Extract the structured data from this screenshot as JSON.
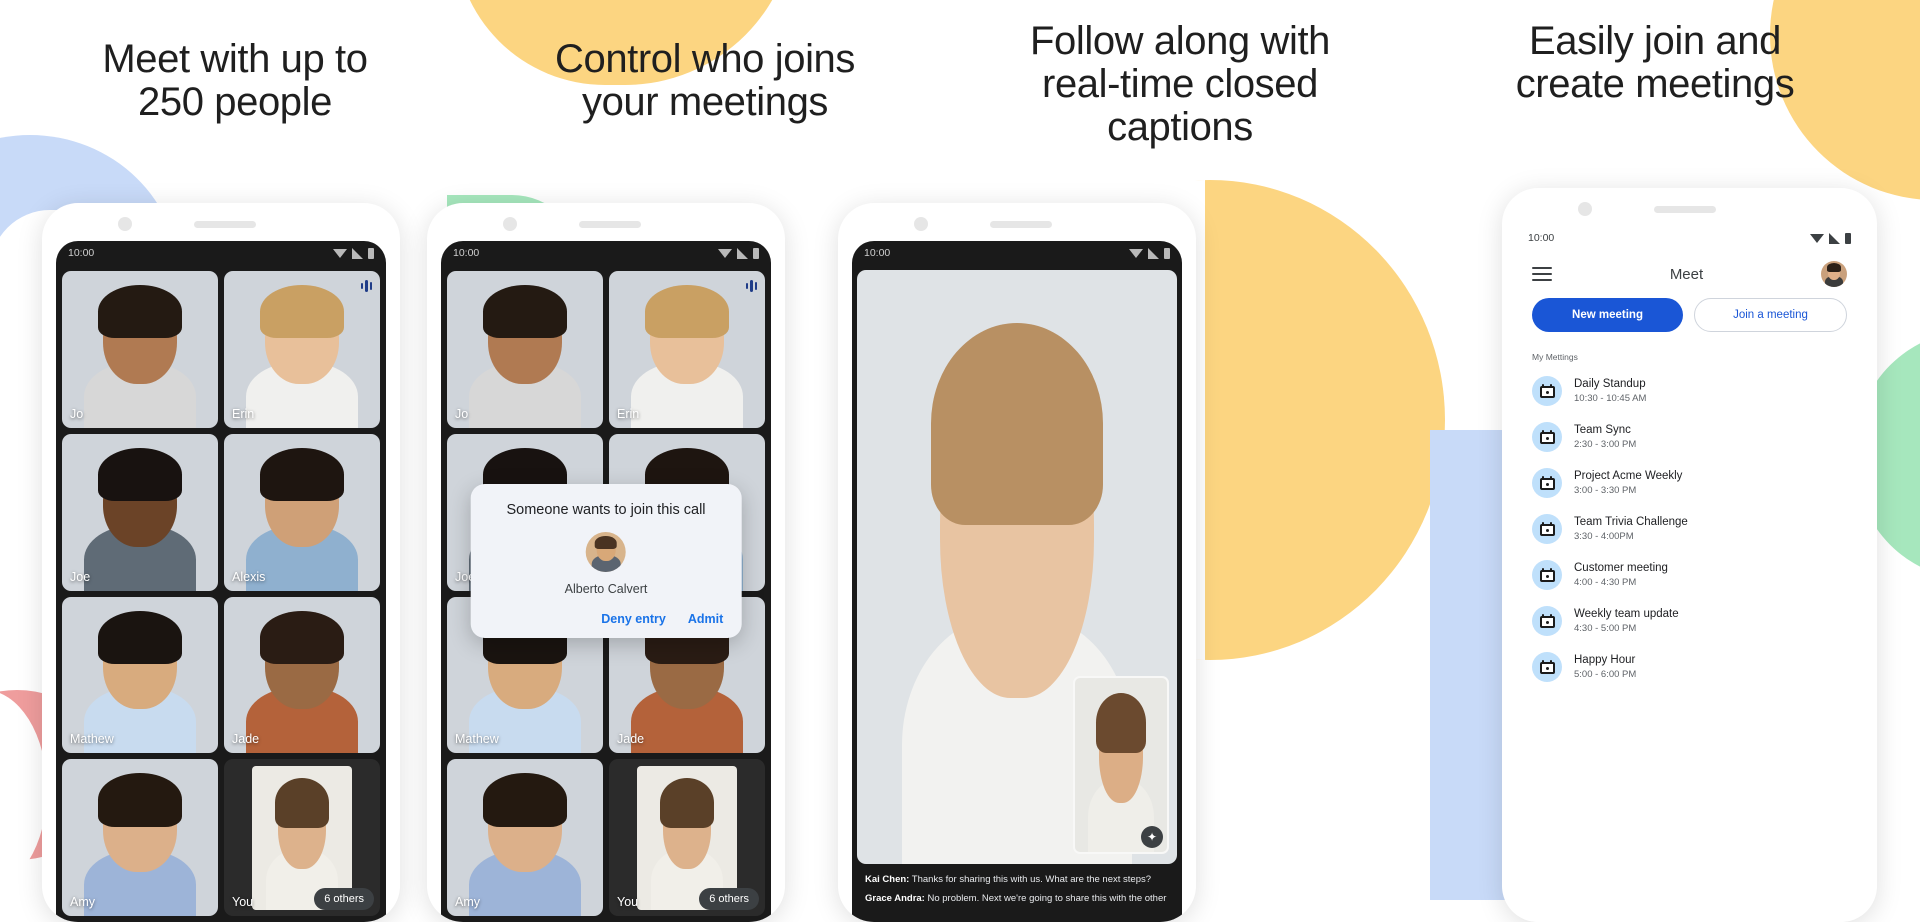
{
  "panels": [
    {
      "heading": "Meet with up to\n250 people"
    },
    {
      "heading": "Control who joins\nyour meetings"
    },
    {
      "heading": "Follow along with\nreal-time closed\ncaptions"
    },
    {
      "heading": "Easily join and\ncreate meetings"
    }
  ],
  "status_bar": {
    "time": "10:00",
    "icons": [
      "wifi-icon",
      "cellular-signal-icon",
      "battery-icon"
    ]
  },
  "call_grid": {
    "participants": [
      {
        "name": "Jo",
        "speaking": false
      },
      {
        "name": "Erin",
        "speaking": true
      },
      {
        "name": "Joe",
        "speaking": false
      },
      {
        "name": "Alexis",
        "speaking": false
      },
      {
        "name": "Mathew",
        "speaking": false
      },
      {
        "name": "Jade",
        "speaking": false
      },
      {
        "name": "Amy",
        "speaking": false
      },
      {
        "name": "You",
        "speaking": false
      }
    ],
    "overflow_chip": "6 others"
  },
  "admit_dialog": {
    "title": "Someone wants to join this call",
    "person_name": "Alberto Calvert",
    "avatar": "person-avatar",
    "deny_label": "Deny entry",
    "admit_label": "Admit"
  },
  "captions": {
    "effects_icon": "sparkle-effects-icon",
    "lines": [
      {
        "speaker": "Kai Chen:",
        "text": " Thanks for sharing this with us. What are the next steps?"
      },
      {
        "speaker": "Grace Andra:",
        "text": " No problem. Next we're going to share this with the other"
      }
    ]
  },
  "meet_home": {
    "menu_icon": "hamburger-menu-icon",
    "app_title": "Meet",
    "avatar": "user-avatar",
    "new_meeting_label": "New meeting",
    "join_meeting_label": "Join a meeting",
    "section_label": "My Mettings",
    "meetings": [
      {
        "title": "Daily Standup",
        "time": "10:30 - 10:45 AM"
      },
      {
        "title": "Team Sync",
        "time": "2:30 - 3:00 PM"
      },
      {
        "title": "Project Acme Weekly",
        "time": "3:00 - 3:30 PM"
      },
      {
        "title": "Team Trivia Challenge",
        "time": "3:30 - 4:00PM"
      },
      {
        "title": "Customer meeting",
        "time": "4:00 - 4:30 PM"
      },
      {
        "title": "Weekly team update",
        "time": "4:30 - 5:00 PM"
      },
      {
        "title": "Happy Hour",
        "time": "5:00 - 6:00 PM"
      }
    ]
  },
  "colors": {
    "brand_blue": "#1a56d6",
    "link_blue": "#1a73e8",
    "blob_blue": "#c8daf8",
    "blob_yellow": "#fcd581",
    "blob_green": "#a6e7bd",
    "blob_pink": "#ef9d9d",
    "text_primary": "#1f1f1f",
    "text_secondary": "#5f6368"
  }
}
